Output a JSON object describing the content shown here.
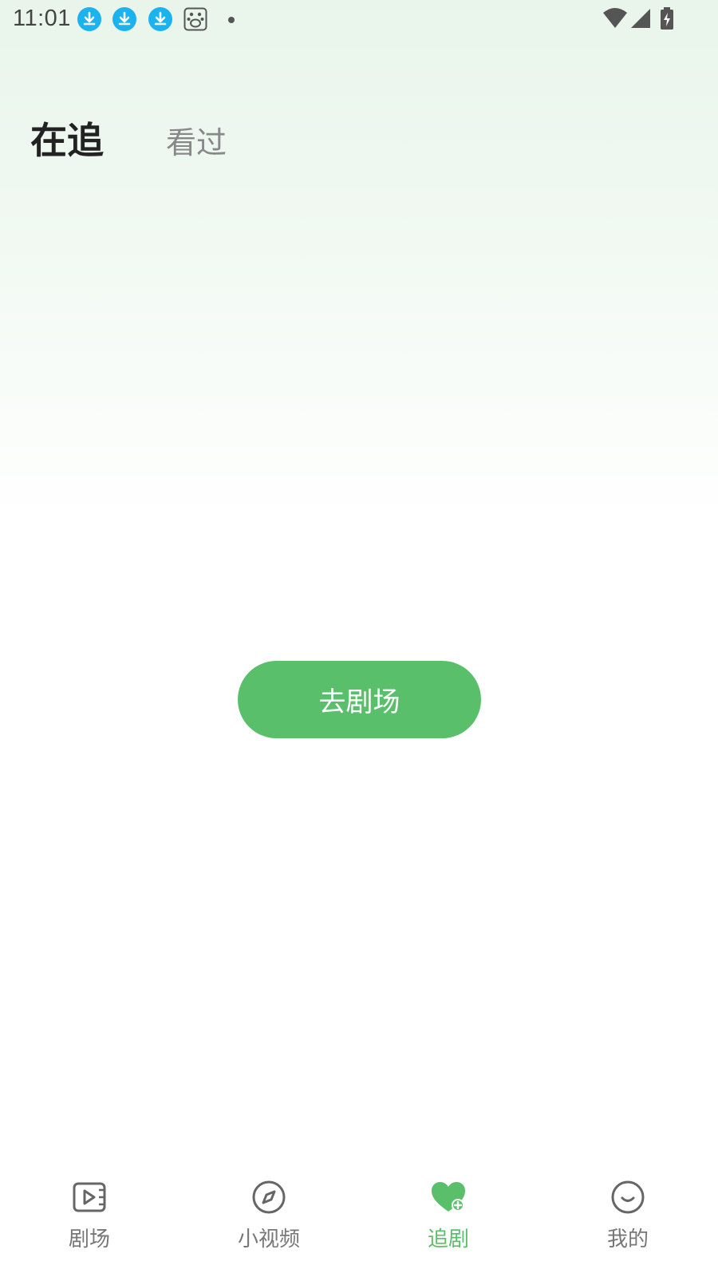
{
  "status_bar": {
    "time": "11:01",
    "left_icons": [
      "download-icon",
      "download-icon",
      "download-icon",
      "baidu-paw-icon",
      "dot-icon"
    ],
    "right_icons": [
      "wifi-icon",
      "signal-icon",
      "battery-charging-icon"
    ]
  },
  "tabs": [
    {
      "label": "在追",
      "active": true
    },
    {
      "label": "看过",
      "active": false
    }
  ],
  "main": {
    "go_button_label": "去剧场"
  },
  "bottom_nav": [
    {
      "label": "剧场",
      "icon": "theater-play-icon",
      "active": false
    },
    {
      "label": "小视频",
      "icon": "compass-icon",
      "active": false
    },
    {
      "label": "追剧",
      "icon": "heart-plus-icon",
      "active": true
    },
    {
      "label": "我的",
      "icon": "smile-icon",
      "active": false
    }
  ],
  "colors": {
    "accent": "#5abf6b",
    "status_blue": "#1ab3f0",
    "inactive": "#777777"
  }
}
